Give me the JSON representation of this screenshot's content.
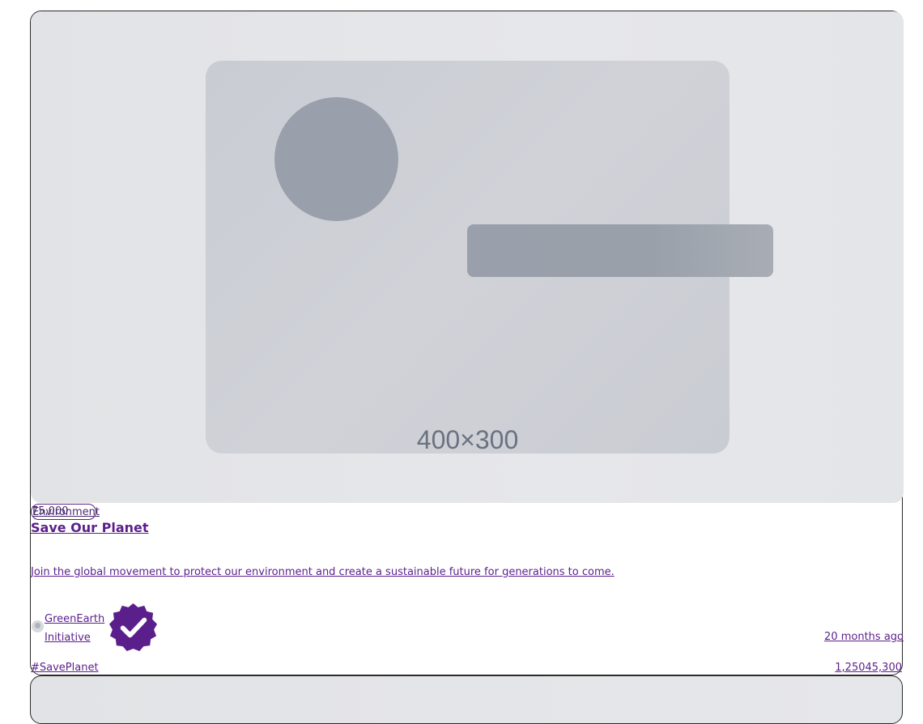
{
  "card": {
    "image_placeholder": "400×300",
    "category": "Environment",
    "overlap_value": "75,000",
    "title": "Save Our Planet",
    "description": "Join the global movement to protect our environment and create a sustainable future for generations to come.",
    "author": "GreenEarth Initiative",
    "verified_icon": "verified-badge-icon",
    "time_ago": "20 months ago",
    "hashtag": "#SavePlanet",
    "stats": "1,25045,300"
  },
  "colors": {
    "accent": "#5b1f8c",
    "placeholder_bg": "#e2e3e6",
    "placeholder_shape": "#99a0ab"
  }
}
